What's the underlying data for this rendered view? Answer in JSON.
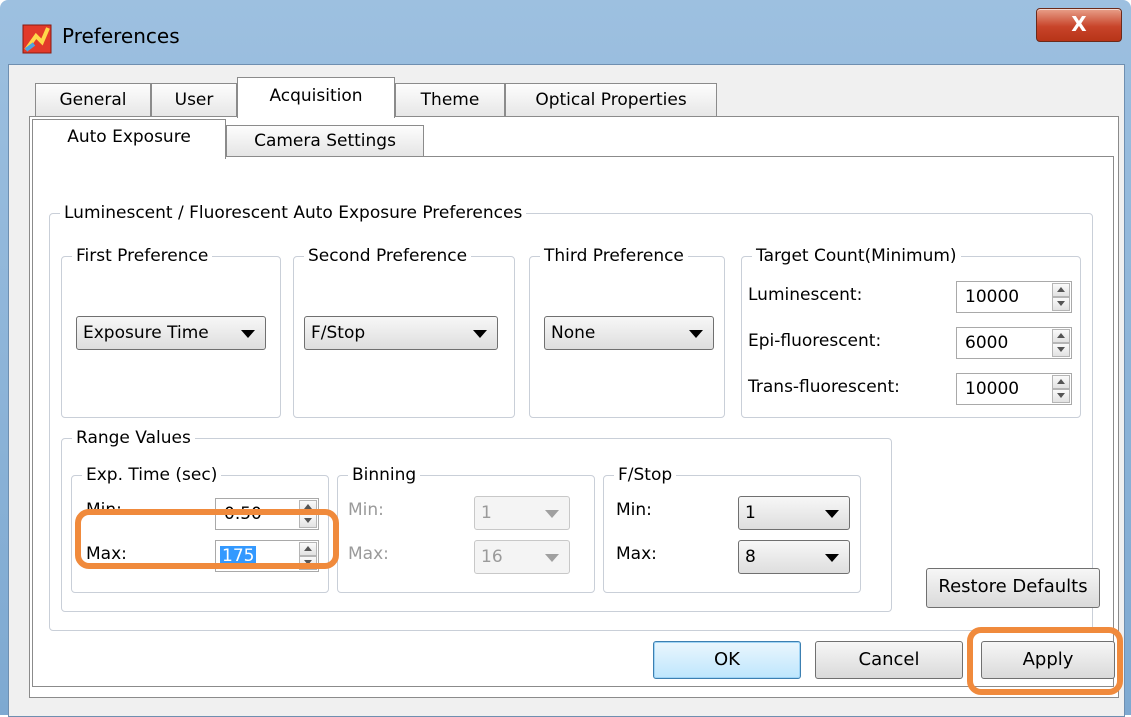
{
  "window": {
    "title": "Preferences",
    "close_glyph": "X",
    "icon": "app-icon"
  },
  "tabs": [
    {
      "label": "General",
      "active": false
    },
    {
      "label": "User",
      "active": false
    },
    {
      "label": "Acquisition",
      "active": true
    },
    {
      "label": "Theme",
      "active": false
    },
    {
      "label": "Optical Properties",
      "active": false
    }
  ],
  "subtabs": [
    {
      "label": "Auto Exposure",
      "active": true
    },
    {
      "label": "Camera Settings",
      "active": false
    }
  ],
  "auto_exposure": {
    "group_title": "Luminescent / Fluorescent Auto Exposure Preferences",
    "first_pref": {
      "title": "First Preference",
      "value": "Exposure Time"
    },
    "second_pref": {
      "title": "Second Preference",
      "value": "F/Stop"
    },
    "third_pref": {
      "title": "Third Preference",
      "value": "None"
    },
    "target": {
      "title": "Target Count(Minimum)",
      "rows": [
        {
          "label": "Luminescent:",
          "value": "10000"
        },
        {
          "label": "Epi-fluorescent:",
          "value": "6000"
        },
        {
          "label": "Trans-fluorescent:",
          "value": "10000"
        }
      ]
    }
  },
  "range": {
    "title": "Range Values",
    "exp_time": {
      "title": "Exp. Time (sec)",
      "min_label": "Min:",
      "min_value": "0.50",
      "max_label": "Max:",
      "max_value": "175"
    },
    "binning": {
      "title": "Binning",
      "min_label": "Min:",
      "min_value": "1",
      "max_label": "Max:",
      "max_value": "16"
    },
    "fstop": {
      "title": "F/Stop",
      "min_label": "Min:",
      "min_value": "1",
      "max_label": "Max:",
      "max_value": "8"
    },
    "restore_label": "Restore Defaults"
  },
  "buttons": {
    "ok": "OK",
    "cancel": "Cancel",
    "apply": "Apply"
  },
  "colors": {
    "highlight": "#f08a3c",
    "selection": "#3399ff"
  }
}
